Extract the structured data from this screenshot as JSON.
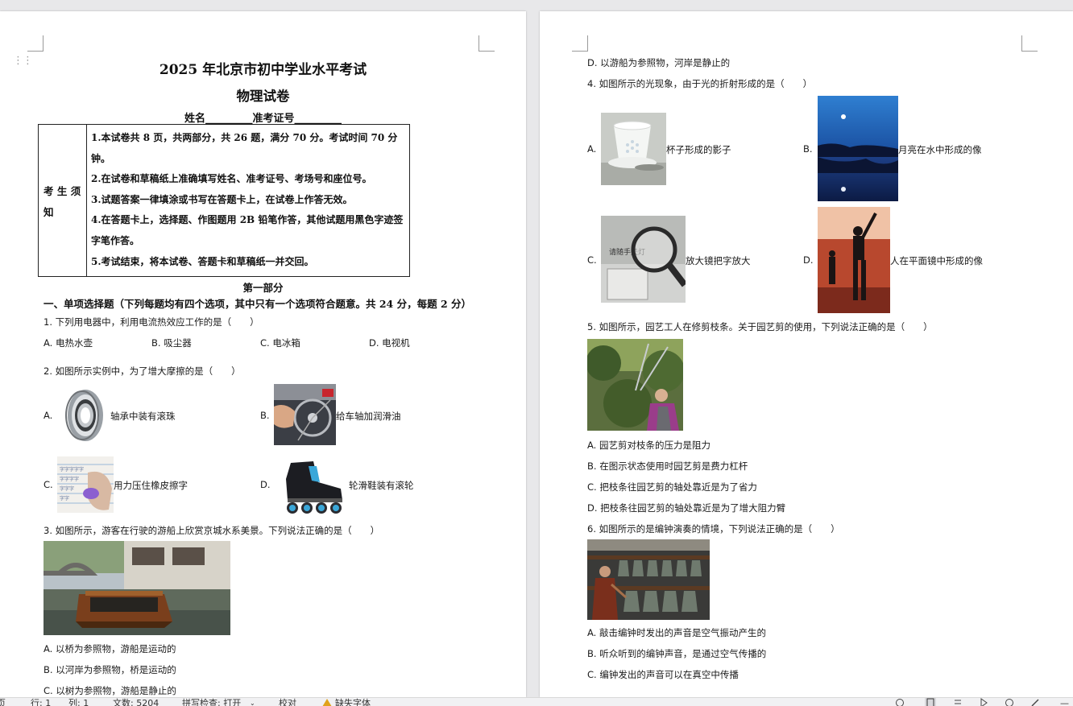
{
  "left_page": {
    "title": "2025 年北京市初中学业水平考试",
    "subtitle": "物理试卷",
    "name_line": "姓名_________准考证号_________",
    "notice": {
      "label": "考 生 须 知",
      "items": [
        "1.本试卷共 8 页，共两部分，共 26 题，满分 70 分。考试时间 70 分钟。",
        "2.在试卷和草稿纸上准确填写姓名、准考证号、考场号和座位号。",
        "3.试题答案一律填涂或书写在答题卡上，在试卷上作答无效。",
        "4.在答题卡上，选择题、作图题用 2B 铅笔作答，其他试题用黑色字迹签字笔作答。",
        "5.考试结束，将本试卷、答题卡和草稿纸一并交回。"
      ]
    },
    "part_title": "第一部分",
    "section_title": "一、单项选择题（下列每题均有四个选项，其中只有一个选项符合题意。共 24 分，每题 2 分）",
    "q1": {
      "stem": "1. 下列用电器中，利用电流热效应工作的是（　　）",
      "options": [
        "A. 电热水壶",
        "B. 吸尘器",
        "C. 电冰箱",
        "D. 电视机"
      ]
    },
    "q2": {
      "stem": "2. 如图所示实例中，为了增大摩擦的是（　　）",
      "options": [
        {
          "letter": "A.",
          "text": "轴承中装有滚珠"
        },
        {
          "letter": "B.",
          "text": "给车轴加润滑油"
        },
        {
          "letter": "C.",
          "text": "用力压住橡皮擦字"
        },
        {
          "letter": "D.",
          "text": "轮滑鞋装有滚轮"
        }
      ]
    },
    "q3": {
      "stem": "3. 如图所示，游客在行驶的游船上欣赏京城水系美景。下列说法正确的是（　　）",
      "options": [
        "A. 以桥为参照物，游船是运动的",
        "B. 以河岸为参照物，桥是运动的",
        "C. 以树为参照物，游船是静止的"
      ]
    }
  },
  "right_page": {
    "q3_d": "D. 以游船为参照物，河岸是静止的",
    "q4": {
      "stem": "4. 如图所示的光现象，由于光的折射形成的是（　　）",
      "options": [
        {
          "letter": "A.",
          "text": "杯子形成的影子"
        },
        {
          "letter": "B.",
          "text": "月亮在水中形成的像"
        },
        {
          "letter": "C.",
          "text": "放大镜把字放大"
        },
        {
          "letter": "D.",
          "text": "人在平面镜中形成的像"
        }
      ],
      "magnifier_label": "请随手关灯"
    },
    "q5": {
      "stem": "5. 如图所示，园艺工人在修剪枝条。关于园艺剪的使用，下列说法正确的是（　　）",
      "options": [
        "A. 园艺剪对枝条的压力是阻力",
        "B. 在图示状态使用时园艺剪是费力杠杆",
        "C. 把枝条往园艺剪的轴处靠近是为了省力",
        "D. 把枝条往园艺剪的轴处靠近是为了增大阻力臂"
      ]
    },
    "q6": {
      "stem": "6. 如图所示的是编钟演奏的情境，下列说法正确的是（　　）",
      "options": [
        "A. 敲击编钟时发出的声音是空气振动产生的",
        "B. 听众听到的编钟声音，是通过空气传播的",
        "C. 编钟发出的声音可以在真空中传播"
      ]
    }
  },
  "status_bar": {
    "page": "页",
    "line": "行: 1",
    "column": "列: 1",
    "word_count": "文数: 5204",
    "spell_check": "拼写检查: 打开",
    "proofread": "校对",
    "missing_font": "缺失字体"
  },
  "colors": {
    "workspace": "#e8e8ea",
    "page": "#ffffff",
    "status_bar": "#f1f1f3",
    "warning": "#e0a21b"
  }
}
